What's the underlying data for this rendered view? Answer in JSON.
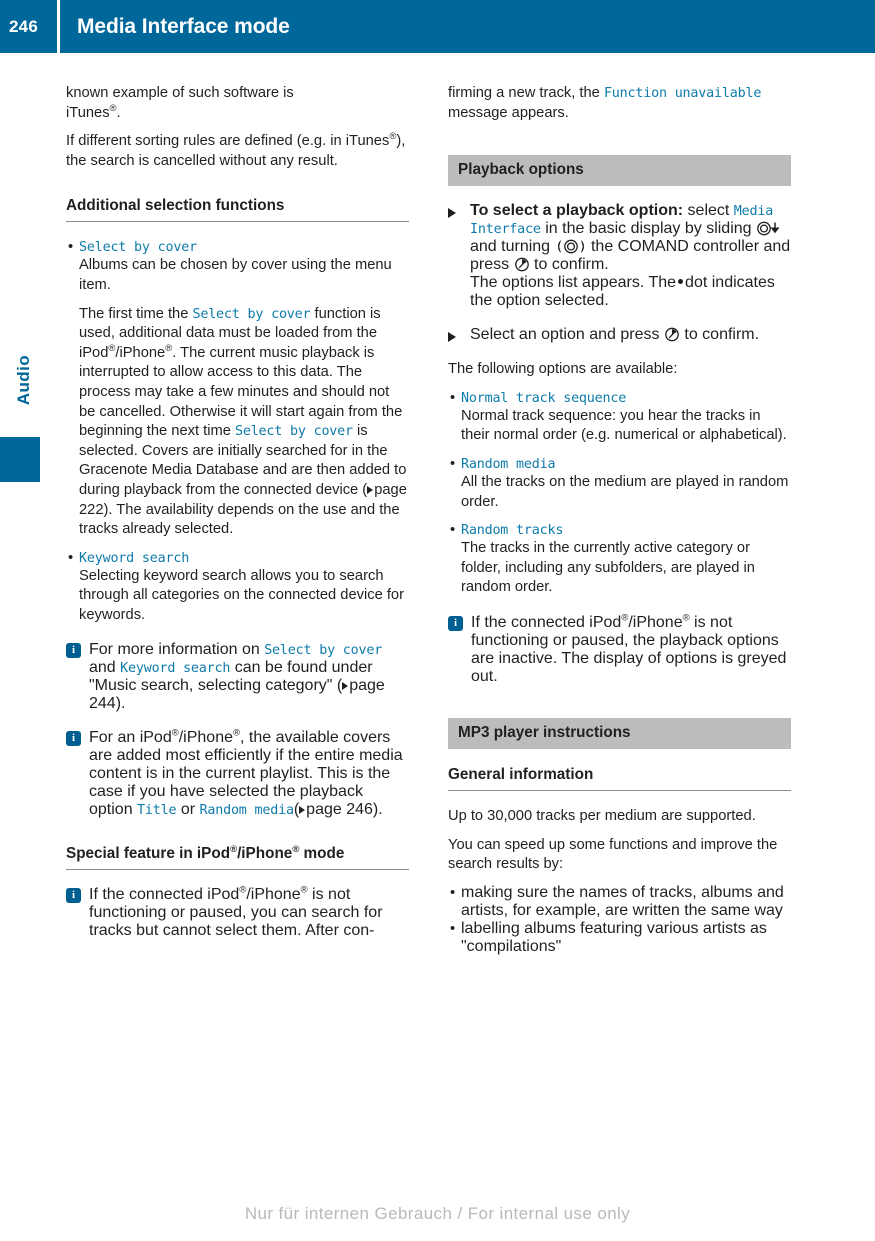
{
  "header": {
    "page_number": "246",
    "title": "Media Interface mode"
  },
  "side_tab": {
    "label": "Audio"
  },
  "footer": {
    "text": "Nur für internen Gebrauch / For internal use only"
  },
  "icons": {
    "info": "i",
    "bullet": "•",
    "step_arrow": "step-arrow-icon",
    "page_ref": "page-ref-triangle-icon",
    "slide_controller": "comand-slide-down-icon",
    "turn_controller": "comand-turn-icon",
    "press_controller": "comand-press-icon"
  },
  "left_column": {
    "para_known_example": {
      "line1": "known example of such software is",
      "line2_pre": "iTunes",
      "line2_post": "."
    },
    "para_sorting_rules": {
      "part1": "If different sorting rules are defined (e.g. in",
      "part2_pre": "iTunes",
      "part2_post": "), the search is cancelled without any result."
    },
    "heading_additional": "Additional selection functions",
    "bullet_select_by_cover": {
      "term": "Select by cover",
      "body_1": "Albums can be chosen by cover using the menu item.",
      "body_2_a": "The first time the",
      "body_2_term": "Select by cover",
      "body_2_b": "function is used, additional data must be loaded from the iPod",
      "body_2_c": "/iPhone",
      "body_2_d": ". The current music playback is interrupted to allow access to this data. The process may take a few minutes and should not be cancelled. Otherwise it will start again from the beginning the next time",
      "body_2_term2": "Select by cover",
      "body_2_e": "is selected. Covers are initially searched for in the Gracenote Media Database and are then added to during playback from the connected device (",
      "body_2_pageref": "page 222",
      "body_2_f": "). The availability depends on the use and the tracks already selected."
    },
    "bullet_keyword_search": {
      "term": "Keyword search",
      "body": "Selecting keyword search allows you to search through all categories on the connected device for keywords."
    },
    "note_more_info": {
      "a": "For more information on",
      "term1": "Select by cover",
      "b": "and",
      "term2": "Keyword search",
      "c": "can be found under \"Music search, selecting category\" (",
      "pageref": "page 244",
      "d": ")."
    },
    "note_ipod_covers": {
      "a": "For an iPod",
      "b": "/iPhone",
      "c": ", the available covers are added most efficiently if the entire media content is in the current playlist. This is the case if you have selected the playback option",
      "term1": "Title",
      "d": "or",
      "term2": "Random media",
      "e": "(",
      "pageref": "page 246",
      "f": ")."
    },
    "heading_special_feature": {
      "a": "Special feature in iPod",
      "b": "/iPhone",
      "c": " mode"
    },
    "note_not_functioning": {
      "a": "If the connected iPod",
      "b": "/iPhone",
      "c": " is not functioning or paused, you can search for tracks but cannot select them. After con-"
    }
  },
  "right_column": {
    "para_continued": {
      "a": "firming a new track, the",
      "term": "Function unavailable",
      "b": "message appears."
    },
    "band_playback_options": "Playback options",
    "step_select_option": {
      "bold": "To select a playback option:",
      "a": "select",
      "term": "Media Interface",
      "b": "in the basic display by sliding",
      "c": "and turning",
      "d": "the COMAND controller and press",
      "e": "to confirm.",
      "f": "The options list appears. The",
      "g": "dot indicates the option selected."
    },
    "step_confirm": {
      "a": "Select an option and press",
      "b": "to confirm."
    },
    "para_following_options": "The following options are available:",
    "options": [
      {
        "term": "Normal track sequence",
        "body": "Normal track sequence: you hear the tracks in their normal order (e.g. numerical or alphabetical)."
      },
      {
        "term": "Random media",
        "body": "All the tracks on the medium are played in random order."
      },
      {
        "term": "Random tracks",
        "body": "The tracks in the currently active category or folder, including any subfolders, are played in random order."
      }
    ],
    "note_inactive": {
      "a": "If the connected iPod",
      "b": "/iPhone",
      "c": " is not functioning or paused, the playback options are inactive. The display of options is greyed out."
    },
    "band_mp3": "MP3 player instructions",
    "heading_general_info": "General information",
    "para_up_to": "Up to 30,000 tracks per medium are supported.",
    "para_speed_up": "You can speed up some functions and improve the search results by:",
    "bullets_tips": [
      "making sure the names of tracks, albums and artists, for example, are written the same way",
      "labelling albums featuring various artists as \"compilations\""
    ]
  },
  "colors": {
    "header_blue": "#00679a",
    "menu_text_blue": "#0f7bab",
    "band_grey": "#bcbcbc",
    "body_text": "#231f20",
    "footer_grey": "#b9b9b9"
  }
}
